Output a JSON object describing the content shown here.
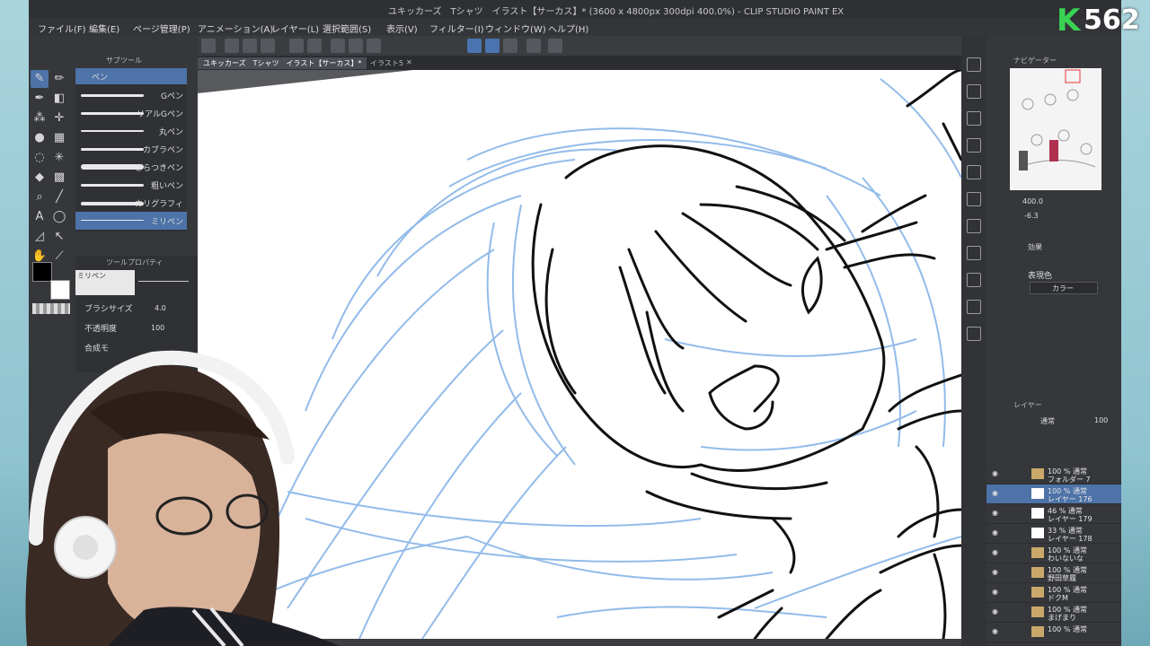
{
  "window": {
    "title": "ユキッカーズ　Tシャツ　イラスト【サーカス】* (3600 x 4800px 300dpi 400.0%)  - CLIP STUDIO PAINT EX"
  },
  "menu": [
    "ファイル(F)",
    "編集(E)",
    "ページ管理(P)",
    "アニメーション(A)",
    "レイヤー(L)",
    "選択範囲(S)",
    "表示(V)",
    "フィルター(I)",
    "ウィンドウ(W)",
    "ヘルプ(H)"
  ],
  "canvas_tabs": [
    {
      "label": "ユキッカーズ　Tシャツ　イラスト【サーカス】*",
      "active": true
    },
    {
      "label": "イラスト5",
      "active": false
    }
  ],
  "subtool": {
    "header": "サブツール",
    "group": "ペン",
    "brushes": [
      "Gペン",
      "リアルGペン",
      "丸ペン",
      "カブラペン",
      "さらつきペン",
      "粗いペン",
      "カリグラフィ",
      "ミリペン"
    ],
    "selected_index": 7
  },
  "tool_property": {
    "header": "ツールプロパティ",
    "preset": "ミリペン",
    "brush_size_label": "ブラシサイズ",
    "brush_size_value": "4.0",
    "opacity_label": "不透明度",
    "opacity_value": "100",
    "blend_label": "合成モ"
  },
  "navigator": {
    "header": "ナビゲーター",
    "zoom": "400.0",
    "rotation": "-6.3"
  },
  "effect_panel": {
    "header": "効果",
    "expression_label": "表現色",
    "expression_value": "カラー"
  },
  "layer_panel": {
    "header": "レイヤー",
    "blend_mode": "通常",
    "opacity": "100",
    "layers": [
      {
        "line1": "100 % 通常",
        "line2": "フォルダー 7",
        "type": "folder",
        "expanded": true,
        "selected": false
      },
      {
        "line1": "100 % 通常",
        "line2": "レイヤー 176",
        "type": "raster",
        "selected": true
      },
      {
        "line1": "46 % 通常",
        "line2": "レイヤー 179",
        "type": "raster",
        "selected": false
      },
      {
        "line1": "33 % 通常",
        "line2": "レイヤー 178",
        "type": "raster",
        "selected": false
      },
      {
        "line1": "100 % 通常",
        "line2": "わいないな",
        "type": "folder",
        "expanded": false,
        "selected": false
      },
      {
        "line1": "100 % 通常",
        "line2": "野田草履",
        "type": "folder",
        "expanded": false,
        "selected": false
      },
      {
        "line1": "100 % 通常",
        "line2": "ドクM",
        "type": "folder",
        "expanded": false,
        "selected": false
      },
      {
        "line1": "100 % 通常",
        "line2": "まげまり",
        "type": "folder",
        "expanded": false,
        "selected": false
      },
      {
        "line1": "100 % 通常",
        "line2": "",
        "type": "folder",
        "expanded": false,
        "selected": false
      }
    ]
  },
  "badge": {
    "letter": "K",
    "count": "562"
  },
  "colors": {
    "accent": "#4d73a8",
    "sketch_blue": "#7fb0e6",
    "ink": "#111111",
    "badge_green": "#39d353"
  }
}
